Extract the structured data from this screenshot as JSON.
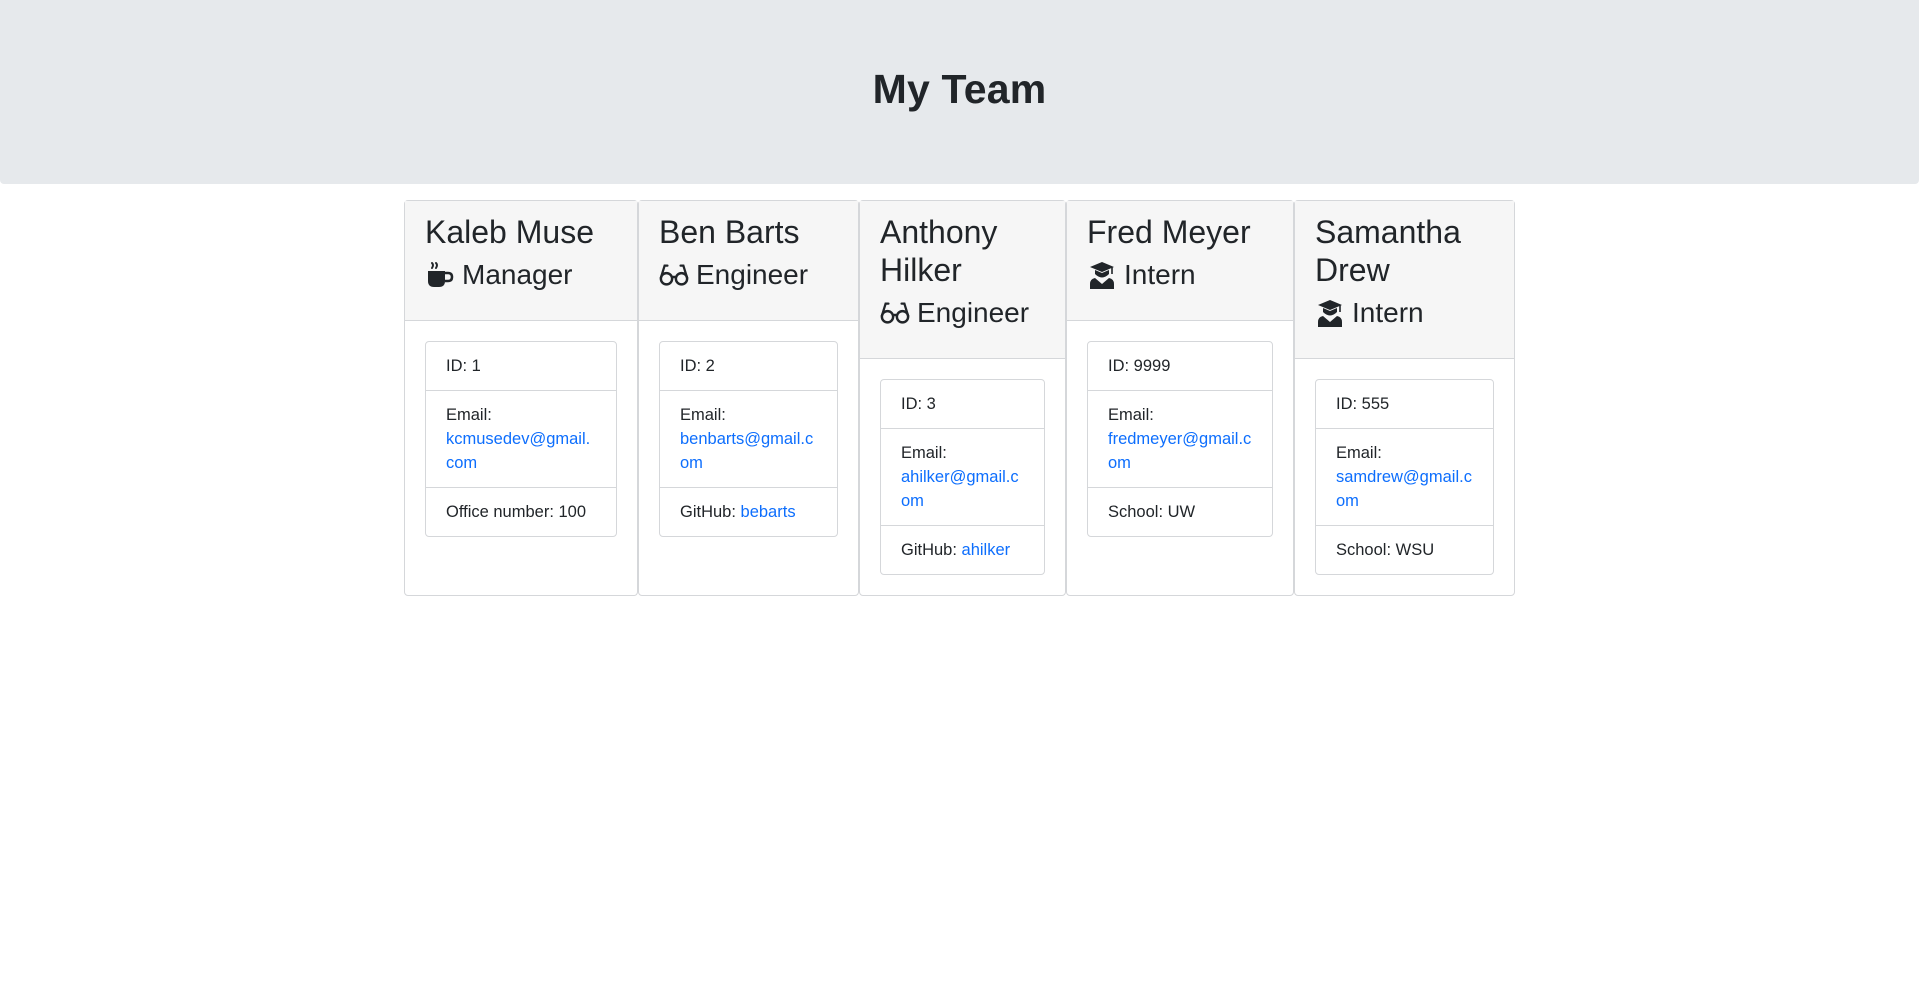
{
  "header": {
    "title": "My Team"
  },
  "team": [
    {
      "name": "Kaleb Muse",
      "role": "Manager",
      "role_icon": "coffee-icon",
      "id_label": "ID: 1",
      "email_label": "Email:",
      "email": "kcmusedev@gmail.com",
      "extra_label": "Office number: 100",
      "extra_link": ""
    },
    {
      "name": "Ben Barts",
      "role": "Engineer",
      "role_icon": "glasses-icon",
      "id_label": "ID: 2",
      "email_label": "Email:",
      "email": "benbarts@gmail.com",
      "extra_label": "GitHub:",
      "extra_link": "bebarts"
    },
    {
      "name": "Anthony Hilker",
      "role": "Engineer",
      "role_icon": "glasses-icon",
      "id_label": "ID: 3",
      "email_label": "Email:",
      "email": "ahilker@gmail.com",
      "extra_label": "GitHub:",
      "extra_link": "ahilker"
    },
    {
      "name": "Fred Meyer",
      "role": "Intern",
      "role_icon": "graduate-icon",
      "id_label": "ID: 9999",
      "email_label": "Email:",
      "email": "fredmeyer@gmail.com",
      "extra_label": "School: UW",
      "extra_link": ""
    },
    {
      "name": "Samantha Drew",
      "role": "Intern",
      "role_icon": "graduate-icon",
      "id_label": "ID: 555",
      "email_label": "Email:",
      "email": "samdrew@gmail.com",
      "extra_label": "School: WSU",
      "extra_link": ""
    }
  ],
  "colors": {
    "link": "#0d6efd",
    "header_bg": "#e6e9ec",
    "card_header_bg": "#f6f6f6"
  }
}
